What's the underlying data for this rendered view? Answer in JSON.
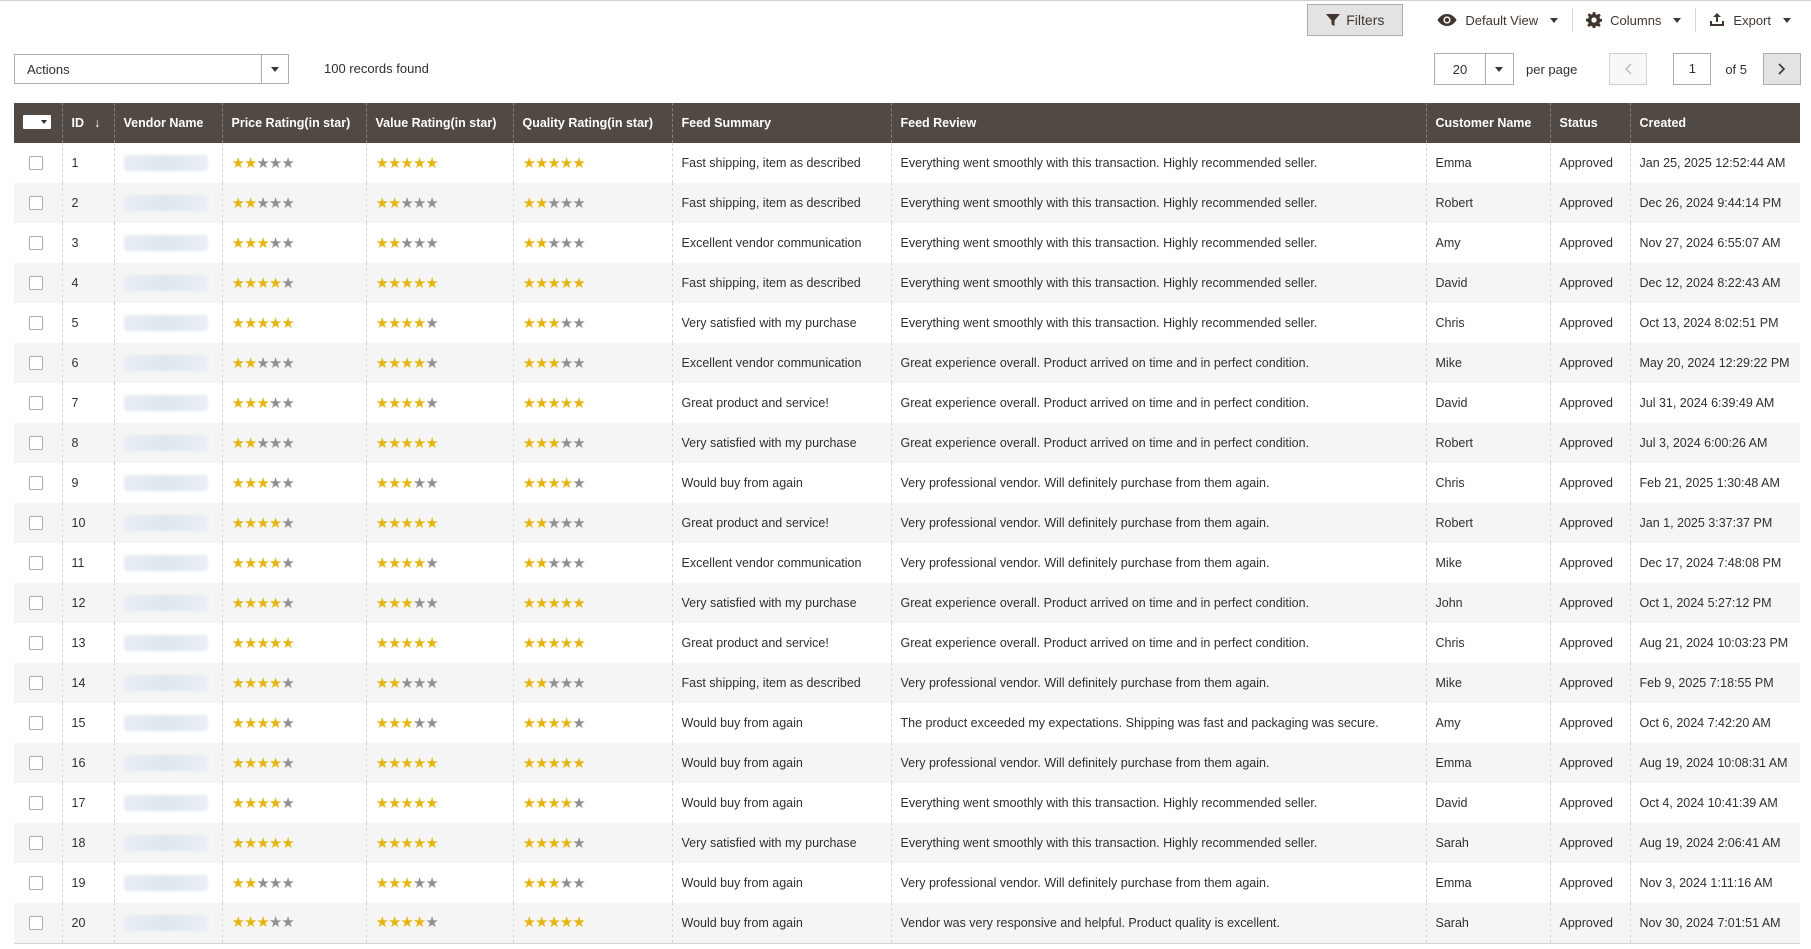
{
  "toolbar": {
    "filters_label": "Filters",
    "view_label": "Default View",
    "columns_label": "Columns",
    "export_label": "Export"
  },
  "actions": {
    "label": "Actions"
  },
  "records_text": "100 records found",
  "pager": {
    "per_page_value": "20",
    "per_page_label": "per page",
    "current_page": "1",
    "of_text": "of 5"
  },
  "colors": {
    "header_bg": "#514943",
    "star_on": "#e5b50f",
    "star_off": "#8f8f8f"
  },
  "columns": [
    "ID",
    "Vendor Name",
    "Price Rating(in star)",
    "Value Rating(in star)",
    "Quality Rating(in star)",
    "Feed Summary",
    "Feed Review",
    "Customer Name",
    "Status",
    "Created"
  ],
  "rows": [
    {
      "id": "1",
      "price": 2,
      "value": 5,
      "quality": 5,
      "summary": "Fast shipping, item as described",
      "review": "Everything went smoothly with this transaction. Highly recommended seller.",
      "customer": "Emma",
      "status": "Approved",
      "created": "Jan 25, 2025 12:52:44 AM"
    },
    {
      "id": "2",
      "price": 2,
      "value": 2,
      "quality": 2,
      "summary": "Fast shipping, item as described",
      "review": "Everything went smoothly with this transaction. Highly recommended seller.",
      "customer": "Robert",
      "status": "Approved",
      "created": "Dec 26, 2024 9:44:14 PM"
    },
    {
      "id": "3",
      "price": 3,
      "value": 2,
      "quality": 2,
      "summary": "Excellent vendor communication",
      "review": "Everything went smoothly with this transaction. Highly recommended seller.",
      "customer": "Amy",
      "status": "Approved",
      "created": "Nov 27, 2024 6:55:07 AM"
    },
    {
      "id": "4",
      "price": 4,
      "value": 5,
      "quality": 5,
      "summary": "Fast shipping, item as described",
      "review": "Everything went smoothly with this transaction. Highly recommended seller.",
      "customer": "David",
      "status": "Approved",
      "created": "Dec 12, 2024 8:22:43 AM"
    },
    {
      "id": "5",
      "price": 5,
      "value": 4,
      "quality": 3,
      "summary": "Very satisfied with my purchase",
      "review": "Everything went smoothly with this transaction. Highly recommended seller.",
      "customer": "Chris",
      "status": "Approved",
      "created": "Oct 13, 2024 8:02:51 PM"
    },
    {
      "id": "6",
      "price": 2,
      "value": 4,
      "quality": 3,
      "summary": "Excellent vendor communication",
      "review": "Great experience overall. Product arrived on time and in perfect condition.",
      "customer": "Mike",
      "status": "Approved",
      "created": "May 20, 2024 12:29:22 PM"
    },
    {
      "id": "7",
      "price": 3,
      "value": 4,
      "quality": 5,
      "summary": "Great product and service!",
      "review": "Great experience overall. Product arrived on time and in perfect condition.",
      "customer": "David",
      "status": "Approved",
      "created": "Jul 31, 2024 6:39:49 AM"
    },
    {
      "id": "8",
      "price": 2,
      "value": 5,
      "quality": 3,
      "summary": "Very satisfied with my purchase",
      "review": "Great experience overall. Product arrived on time and in perfect condition.",
      "customer": "Robert",
      "status": "Approved",
      "created": "Jul 3, 2024 6:00:26 AM"
    },
    {
      "id": "9",
      "price": 3,
      "value": 3,
      "quality": 4,
      "summary": "Would buy from again",
      "review": "Very professional vendor. Will definitely purchase from them again.",
      "customer": "Chris",
      "status": "Approved",
      "created": "Feb 21, 2025 1:30:48 AM"
    },
    {
      "id": "10",
      "price": 4,
      "value": 5,
      "quality": 2,
      "summary": "Great product and service!",
      "review": "Very professional vendor. Will definitely purchase from them again.",
      "customer": "Robert",
      "status": "Approved",
      "created": "Jan 1, 2025 3:37:37 PM"
    },
    {
      "id": "11",
      "price": 4,
      "value": 4,
      "quality": 2,
      "summary": "Excellent vendor communication",
      "review": "Very professional vendor. Will definitely purchase from them again.",
      "customer": "Mike",
      "status": "Approved",
      "created": "Dec 17, 2024 7:48:08 PM"
    },
    {
      "id": "12",
      "price": 4,
      "value": 3,
      "quality": 5,
      "summary": "Very satisfied with my purchase",
      "review": "Great experience overall. Product arrived on time and in perfect condition.",
      "customer": "John",
      "status": "Approved",
      "created": "Oct 1, 2024 5:27:12 PM"
    },
    {
      "id": "13",
      "price": 5,
      "value": 5,
      "quality": 5,
      "summary": "Great product and service!",
      "review": "Great experience overall. Product arrived on time and in perfect condition.",
      "customer": "Chris",
      "status": "Approved",
      "created": "Aug 21, 2024 10:03:23 PM"
    },
    {
      "id": "14",
      "price": 4,
      "value": 2,
      "quality": 2,
      "summary": "Fast shipping, item as described",
      "review": "Very professional vendor. Will definitely purchase from them again.",
      "customer": "Mike",
      "status": "Approved",
      "created": "Feb 9, 2025 7:18:55 PM"
    },
    {
      "id": "15",
      "price": 4,
      "value": 3,
      "quality": 4,
      "summary": "Would buy from again",
      "review": "The product exceeded my expectations. Shipping was fast and packaging was secure.",
      "customer": "Amy",
      "status": "Approved",
      "created": "Oct 6, 2024 7:42:20 AM"
    },
    {
      "id": "16",
      "price": 4,
      "value": 5,
      "quality": 5,
      "summary": "Would buy from again",
      "review": "Very professional vendor. Will definitely purchase from them again.",
      "customer": "Emma",
      "status": "Approved",
      "created": "Aug 19, 2024 10:08:31 AM"
    },
    {
      "id": "17",
      "price": 4,
      "value": 5,
      "quality": 4,
      "summary": "Would buy from again",
      "review": "Everything went smoothly with this transaction. Highly recommended seller.",
      "customer": "David",
      "status": "Approved",
      "created": "Oct 4, 2024 10:41:39 AM"
    },
    {
      "id": "18",
      "price": 5,
      "value": 5,
      "quality": 4,
      "summary": "Very satisfied with my purchase",
      "review": "Everything went smoothly with this transaction. Highly recommended seller.",
      "customer": "Sarah",
      "status": "Approved",
      "created": "Aug 19, 2024 2:06:41 AM"
    },
    {
      "id": "19",
      "price": 2,
      "value": 3,
      "quality": 3,
      "summary": "Would buy from again",
      "review": "Very professional vendor. Will definitely purchase from them again.",
      "customer": "Emma",
      "status": "Approved",
      "created": "Nov 3, 2024 1:11:16 AM"
    },
    {
      "id": "20",
      "price": 3,
      "value": 4,
      "quality": 5,
      "summary": "Would buy from again",
      "review": "Vendor was very responsive and helpful. Product quality is excellent.",
      "customer": "Sarah",
      "status": "Approved",
      "created": "Nov 30, 2024 7:01:51 AM"
    }
  ]
}
